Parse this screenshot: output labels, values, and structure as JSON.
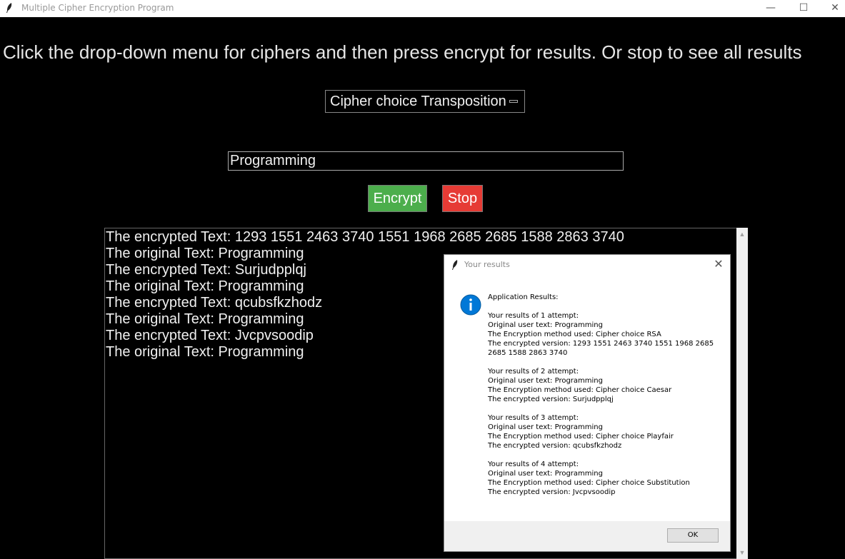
{
  "window": {
    "title": "Multiple Cipher Encryption Program",
    "controls": {
      "minimize": "—",
      "maximize": "☐",
      "close": "✕"
    }
  },
  "instructions": "Click the drop-down menu for ciphers and then press encrypt for results. Or stop to see all results",
  "cipher_menu": {
    "selected": "Cipher choice Transposition"
  },
  "text_input": {
    "value": "Programming"
  },
  "buttons": {
    "encrypt": "Encrypt",
    "stop": "Stop"
  },
  "colors": {
    "encrypt_button": "#4cae4c",
    "stop_button": "#e63b35",
    "background": "#000000",
    "info_icon": "#0078d7"
  },
  "results": [
    "The encrypted Text: 1293 1551 2463 3740 1551 1968 2685 2685 1588 2863 3740",
    "The original Text: Programming",
    "The encrypted Text: Surjudpplqj",
    "The original Text: Programming",
    "The encrypted Text: qcubsfkzhodz",
    "The original Text: Programming",
    "The encrypted Text: Jvcpvsoodip",
    "The original Text: Programming"
  ],
  "dialog": {
    "title": "Your results",
    "icon": "info-icon",
    "message_lines": [
      "Application Results:",
      "",
      "Your results of 1 attempt:",
      "Original user text: Programming",
      "The Encryption method used: Cipher choice RSA",
      "The encrypted version: 1293 1551 2463 3740 1551 1968 2685 2685 1588 2863 3740",
      "",
      "Your results of 2 attempt:",
      "Original user text: Programming",
      "The Encryption method used: Cipher choice Caesar",
      "The encrypted version: Surjudpplqj",
      "",
      "Your results of 3 attempt:",
      "Original user text: Programming",
      "The Encryption method used: Cipher choice Playfair",
      "The encrypted version: qcubsfkzhodz",
      "",
      "Your results of 4 attempt:",
      "Original user text: Programming",
      "The Encryption method used: Cipher choice Substitution",
      "The encrypted version: Jvcpvsoodip"
    ],
    "ok_label": "OK",
    "close": "✕"
  }
}
